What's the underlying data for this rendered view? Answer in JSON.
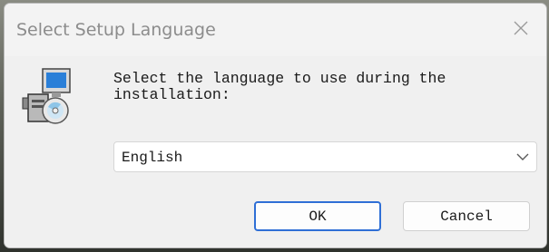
{
  "window": {
    "title": "Select Setup Language",
    "close_icon": "close-icon"
  },
  "main": {
    "icon": "setup-installer-icon",
    "prompt": "Select the language to use during the\ninstallation:",
    "language_select": {
      "selected": "English",
      "icon": "chevron-down-icon"
    }
  },
  "buttons": {
    "ok_label": "OK",
    "cancel_label": "Cancel"
  },
  "colors": {
    "accent": "#2f6fd6",
    "dialog_bg": "#f0f0f0"
  }
}
